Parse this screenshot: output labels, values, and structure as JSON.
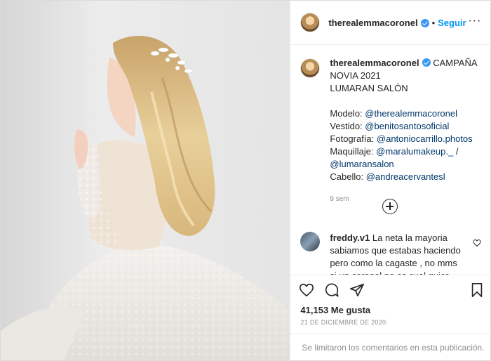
{
  "header": {
    "username": "therealemmacoronel",
    "separator": "•",
    "follow_label": "Seguir",
    "more_label": "···"
  },
  "caption": {
    "username": "therealemmacoronel",
    "line1": "CAMPAÑA",
    "line2": "NOVIA 2021",
    "line3": "LUMARAN SALÓN",
    "credits": [
      {
        "label": "Modelo: ",
        "mention": "@therealemmacoronel"
      },
      {
        "label": "Vestido: ",
        "mention": "@benitosantosoficial"
      },
      {
        "label": "Fotografía: ",
        "mention": "@antoniocarrillo.photos"
      },
      {
        "label": "Maquillaje: ",
        "mention": "@maralumakeup._",
        "suffix": " /"
      },
      {
        "label": "",
        "mention": "@lumaransalon"
      },
      {
        "label": "Cabello: ",
        "mention": "@andreacervantesl"
      }
    ],
    "time": "9 sem"
  },
  "comment": {
    "username": "freddy.v1",
    "text": "La neta la mayoria sabiamos que estabas haciendo pero como la cagaste , no mms si un coronel no es cual quier"
  },
  "likes": "41,153 Me gusta",
  "date": "21 DE DICIEMBRE DE 2020",
  "comments_limited": "Se limitaron los comentarios en esta publicación.",
  "colors": {
    "follow": "#0095f6",
    "verified": "#3897f0",
    "mention": "#00376b",
    "muted": "#8e8e8e"
  }
}
